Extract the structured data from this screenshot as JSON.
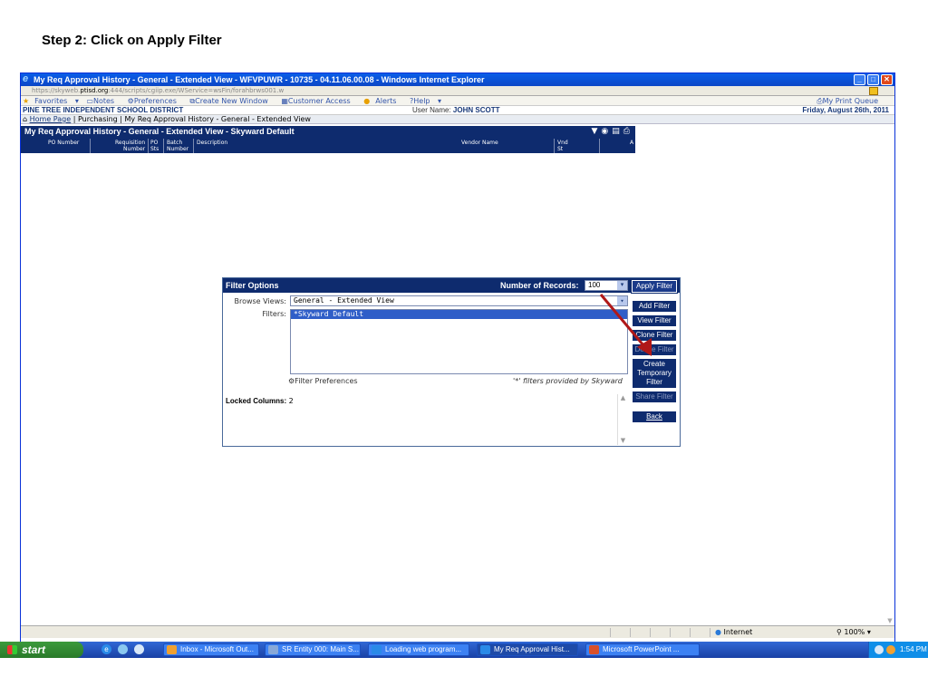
{
  "slide": {
    "title": "Step 2: Click on Apply Filter"
  },
  "window": {
    "title": "My Req Approval History - General - Extended View - WFVPUWR - 10735 - 04.11.06.00.08 - Windows Internet Explorer"
  },
  "address": {
    "scheme": "https://skyweb.",
    "domain": "ptisd.org",
    "path": ":444/scripts/cgiip.exe/WService=wsFin/forahbrws001.w"
  },
  "favbar": {
    "favorites": "Favorites",
    "notes": "Notes",
    "preferences": "Preferences",
    "create_window": "Create New Window",
    "customer_access": "Customer Access",
    "alerts": "Alerts",
    "help": "Help",
    "print_queue": "My Print Queue"
  },
  "header": {
    "district": "PINE TREE INDEPENDENT SCHOOL DISTRICT",
    "user_label": "User Name:",
    "user_name": "JOHN SCOTT",
    "date": "Friday, August 26th, 2011"
  },
  "breadcrumb": {
    "home": "Home Page",
    "path": " | Purchasing | My Req Approval History - General - Extended View"
  },
  "browse": {
    "title": "My Req Approval History - General - Extended View - Skyward Default",
    "columns": [
      {
        "line1": "",
        "line2": "PO Number"
      },
      {
        "line1": "Requisition",
        "line2": "Number"
      },
      {
        "line1": "PO",
        "line2": "Sts"
      },
      {
        "line1": "Batch",
        "line2": "Number"
      },
      {
        "line1": "",
        "line2": "Description"
      },
      {
        "line1": "",
        "line2": "Vendor Name"
      },
      {
        "line1": "Vnd",
        "line2": "St"
      },
      {
        "line1": "",
        "line2": "A"
      }
    ]
  },
  "filter": {
    "title": "Filter Options",
    "records_label": "Number of Records:",
    "records_value": "100",
    "browse_views_label": "Browse Views:",
    "browse_views_value": "General - Extended View",
    "filters_label": "Filters:",
    "filters": [
      "*Skyward Default"
    ],
    "preferences_link": "Filter Preferences",
    "note": "'*' filters provided by Skyward",
    "locked_label": "Locked Columns:",
    "locked_value": "2",
    "buttons": {
      "apply": "Apply Filter",
      "add": "Add Filter",
      "view": "View Filter",
      "clone": "Clone Filter",
      "delete": "Delete Filter",
      "temporary": "Create Temporary Filter",
      "share": "Share Filter",
      "back": "Back"
    }
  },
  "status": {
    "zone": "Internet",
    "zoom": "100%"
  },
  "taskbar": {
    "start": "start",
    "items": [
      "Inbox - Microsoft Out...",
      "SR Entity 000: Main S...",
      "Loading web program...",
      "My Req Approval Hist...",
      "Microsoft PowerPoint ..."
    ],
    "clock": "1:54 PM"
  },
  "colors": {
    "header_navy": "#0e2b6e",
    "selection_blue": "#2f5ec8",
    "arrow_red": "#b01818"
  }
}
